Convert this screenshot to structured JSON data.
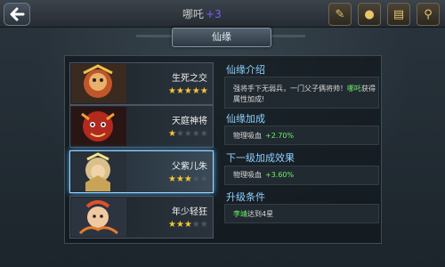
{
  "header": {
    "name": "哪吒",
    "plus": "+3"
  },
  "tab": {
    "label": "仙缘"
  },
  "top_icons": [
    "scroll-icon",
    "coin-icon",
    "book-icon",
    "magnifier-icon"
  ],
  "cards": [
    {
      "name": "生死之交",
      "stars": 5,
      "selected": false,
      "portrait": "red-monkey-portrait"
    },
    {
      "name": "天庭神将",
      "stars": 1,
      "selected": false,
      "portrait": "red-demon-portrait"
    },
    {
      "name": "父紫儿朱",
      "stars": 3,
      "selected": true,
      "portrait": "golden-warrior-portrait"
    },
    {
      "name": "年少轻狂",
      "stars": 3,
      "selected": false,
      "portrait": "child-fire-portrait"
    }
  ],
  "sections": {
    "intro_title": "仙缘介绍",
    "intro_text_1": "强将手下无弱兵，一门父子俩将帅！",
    "intro_highlight": "哪吒",
    "intro_text_2": "获得属性加成!",
    "bonus_title": "仙缘加成",
    "bonus_stat_label": "物理吸血",
    "bonus_stat_value": "+2.70%",
    "next_title": "下一级加成效果",
    "next_stat_label": "物理吸血",
    "next_stat_value": "+3.60%",
    "upgrade_title": "升级条件",
    "upgrade_name": "李靖",
    "upgrade_text": "达到4星"
  },
  "colors": {
    "accent_blue": "#8fd1ff",
    "green_value": "#6cf06a",
    "star_gold": "#f7c534",
    "plus_purple": "#7b5cff"
  }
}
